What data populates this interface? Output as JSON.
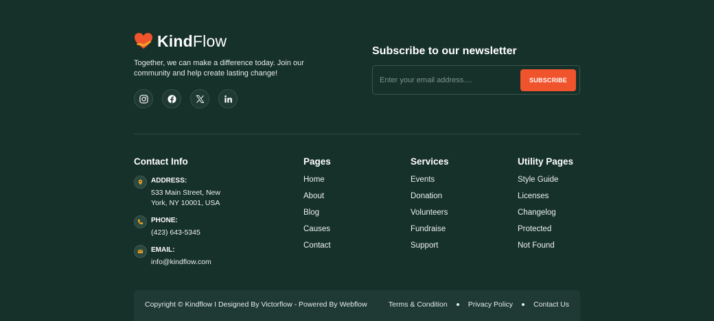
{
  "brand": {
    "name_bold": "Kind",
    "name_light": "Flow",
    "tagline": "Together, we can make a difference today. Join our community and help create lasting change!",
    "icon": "heart-hand-icon",
    "accent": "#f0542d",
    "accent_secondary": "#f5a623"
  },
  "socials": [
    {
      "name": "instagram",
      "icon": "instagram-icon"
    },
    {
      "name": "facebook",
      "icon": "facebook-icon"
    },
    {
      "name": "x",
      "icon": "x-icon"
    },
    {
      "name": "linkedin",
      "icon": "linkedin-icon"
    }
  ],
  "newsletter": {
    "title": "Subscribe to our newsletter",
    "placeholder": "Enter your email address....",
    "button": "SUBSCRIBE"
  },
  "contact": {
    "title": "Contact Info",
    "items": [
      {
        "icon": "map-pin-icon",
        "label": "ADDRESS:",
        "value": "533 Main Street, New York, NY 10001, USA"
      },
      {
        "icon": "phone-icon",
        "label": "PHONE:",
        "value": "(423) 643-5345"
      },
      {
        "icon": "mail-icon",
        "label": "EMAIL:",
        "value": "info@kindflow.com"
      }
    ]
  },
  "columns": [
    {
      "title": "Pages",
      "links": [
        "Home",
        "About",
        "Blog",
        "Causes",
        "Contact"
      ]
    },
    {
      "title": "Services",
      "links": [
        "Events",
        "Donation",
        "Volunteers",
        "Fundraise",
        "Support"
      ]
    },
    {
      "title": "Utility Pages",
      "links": [
        "Style Guide",
        "Licenses",
        "Changelog",
        "Protected",
        "Not Found"
      ]
    }
  ],
  "bottom": {
    "copyright": "Copyright © Kindflow I Designed By Victorflow - Powered By Webflow",
    "links": [
      "Terms & Condition",
      "Privacy Policy",
      "Contact Us"
    ]
  },
  "colors": {
    "background": "#16302a",
    "bottom_bar": "#1f3a34"
  }
}
